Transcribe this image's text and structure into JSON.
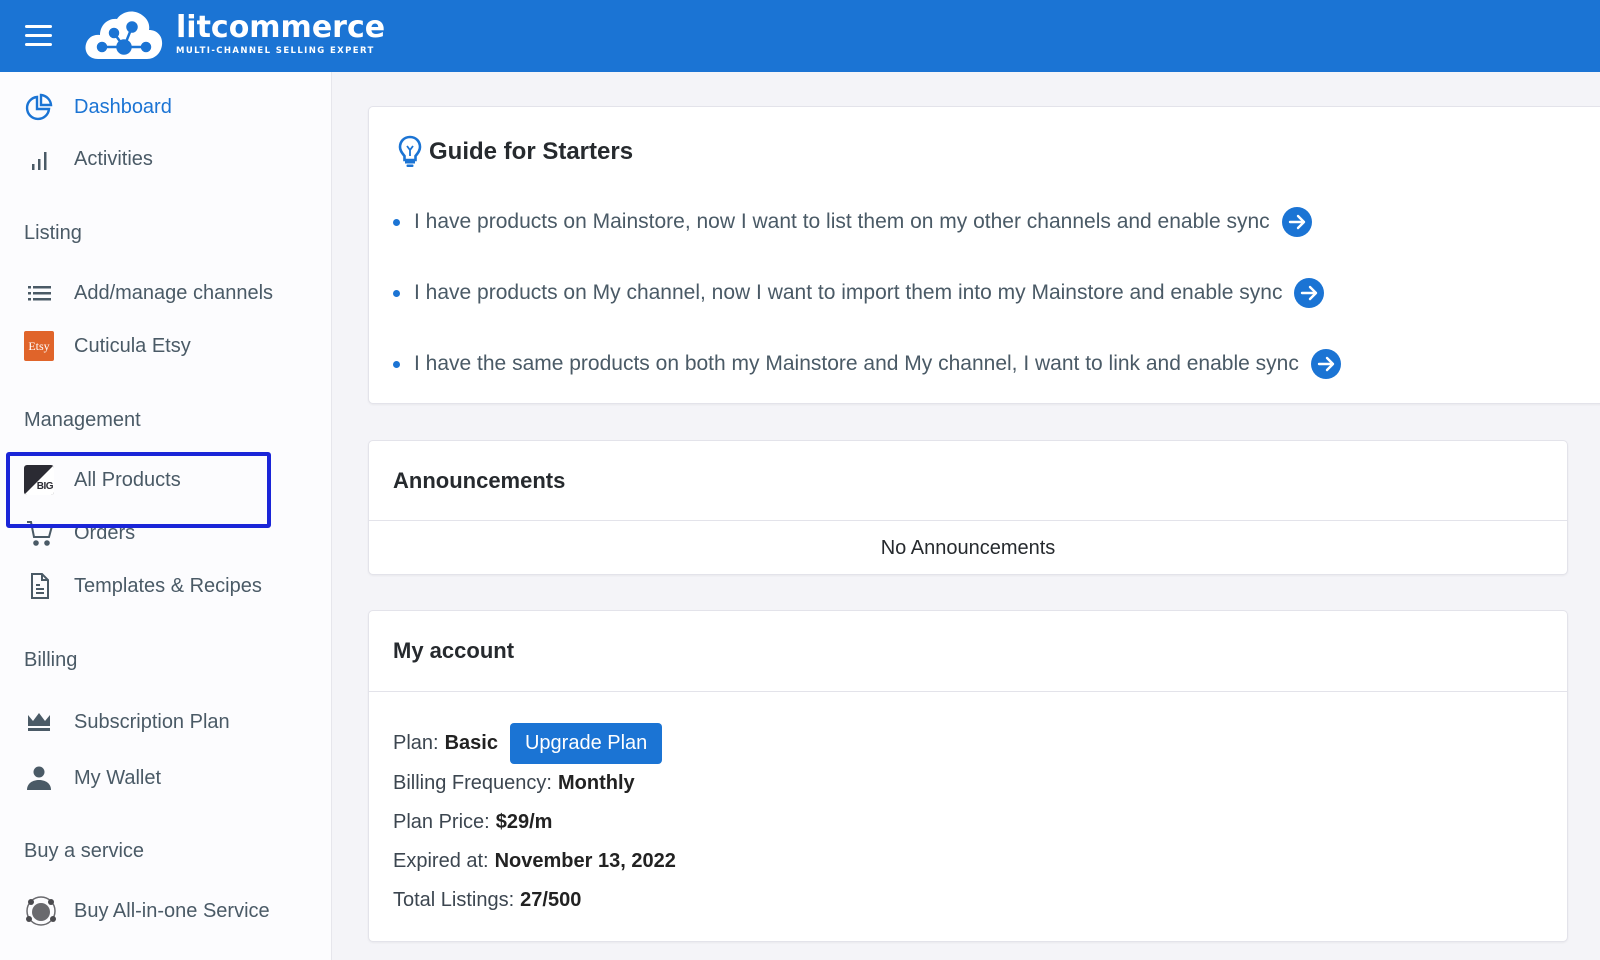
{
  "header": {
    "menu_icon": "hamburger-menu-icon",
    "brand_name": "litcommerce",
    "brand_tagline": "MULTI-CHANNEL SELLING EXPERT",
    "brand_color": "#1b74d4"
  },
  "sidebar": {
    "top_items": [
      {
        "label": "Dashboard",
        "icon": "pie-chart-icon",
        "active": true
      },
      {
        "label": "Activities",
        "icon": "bar-chart-icon",
        "active": false
      }
    ],
    "sections": [
      {
        "title": "Listing",
        "items": [
          {
            "label": "Add/manage channels",
            "icon": "list-icon"
          },
          {
            "label": "Cuticula Etsy",
            "icon": "etsy-icon",
            "icon_text": "Etsy"
          }
        ]
      },
      {
        "title": "Management",
        "items": [
          {
            "label": "All Products",
            "icon": "bigcommerce-icon",
            "icon_text": "BIG",
            "highlighted": true
          },
          {
            "label": "Orders",
            "icon": "cart-icon"
          },
          {
            "label": "Templates & Recipes",
            "icon": "document-icon"
          }
        ]
      },
      {
        "title": "Billing",
        "items": [
          {
            "label": "Subscription Plan",
            "icon": "crown-icon"
          },
          {
            "label": "My Wallet",
            "icon": "user-icon"
          }
        ]
      },
      {
        "title": "Buy a service",
        "items": [
          {
            "label": "Buy All-in-one Service",
            "icon": "network-sphere-icon"
          }
        ]
      }
    ],
    "highlight_color": "#1a25d8"
  },
  "guide": {
    "title": "Guide for Starters",
    "icon": "lightbulb-icon",
    "items": [
      {
        "text": "I have products on Mainstore, now I want to list them on my other channels and enable sync",
        "action_icon": "arrow-right-circle-icon"
      },
      {
        "text": "I have products on My channel, now I want to import them into my Mainstore and enable sync",
        "action_icon": "arrow-right-circle-icon"
      },
      {
        "text": "I have the same products on both my Mainstore and My channel, I want to link and enable sync",
        "action_icon": "arrow-right-circle-icon"
      }
    ]
  },
  "announcements": {
    "title": "Announcements",
    "empty_text": "No Announcements"
  },
  "account": {
    "title": "My account",
    "plan_label": "Plan:",
    "plan_value": "Basic",
    "upgrade_button": "Upgrade Plan",
    "billing_label": "Billing Frequency:",
    "billing_value": "Monthly",
    "price_label": "Plan Price:",
    "price_value": "$29/m",
    "expired_label": "Expired at:",
    "expired_value": "November 13, 2022",
    "listings_label": "Total Listings:",
    "listings_value": "27/500"
  }
}
